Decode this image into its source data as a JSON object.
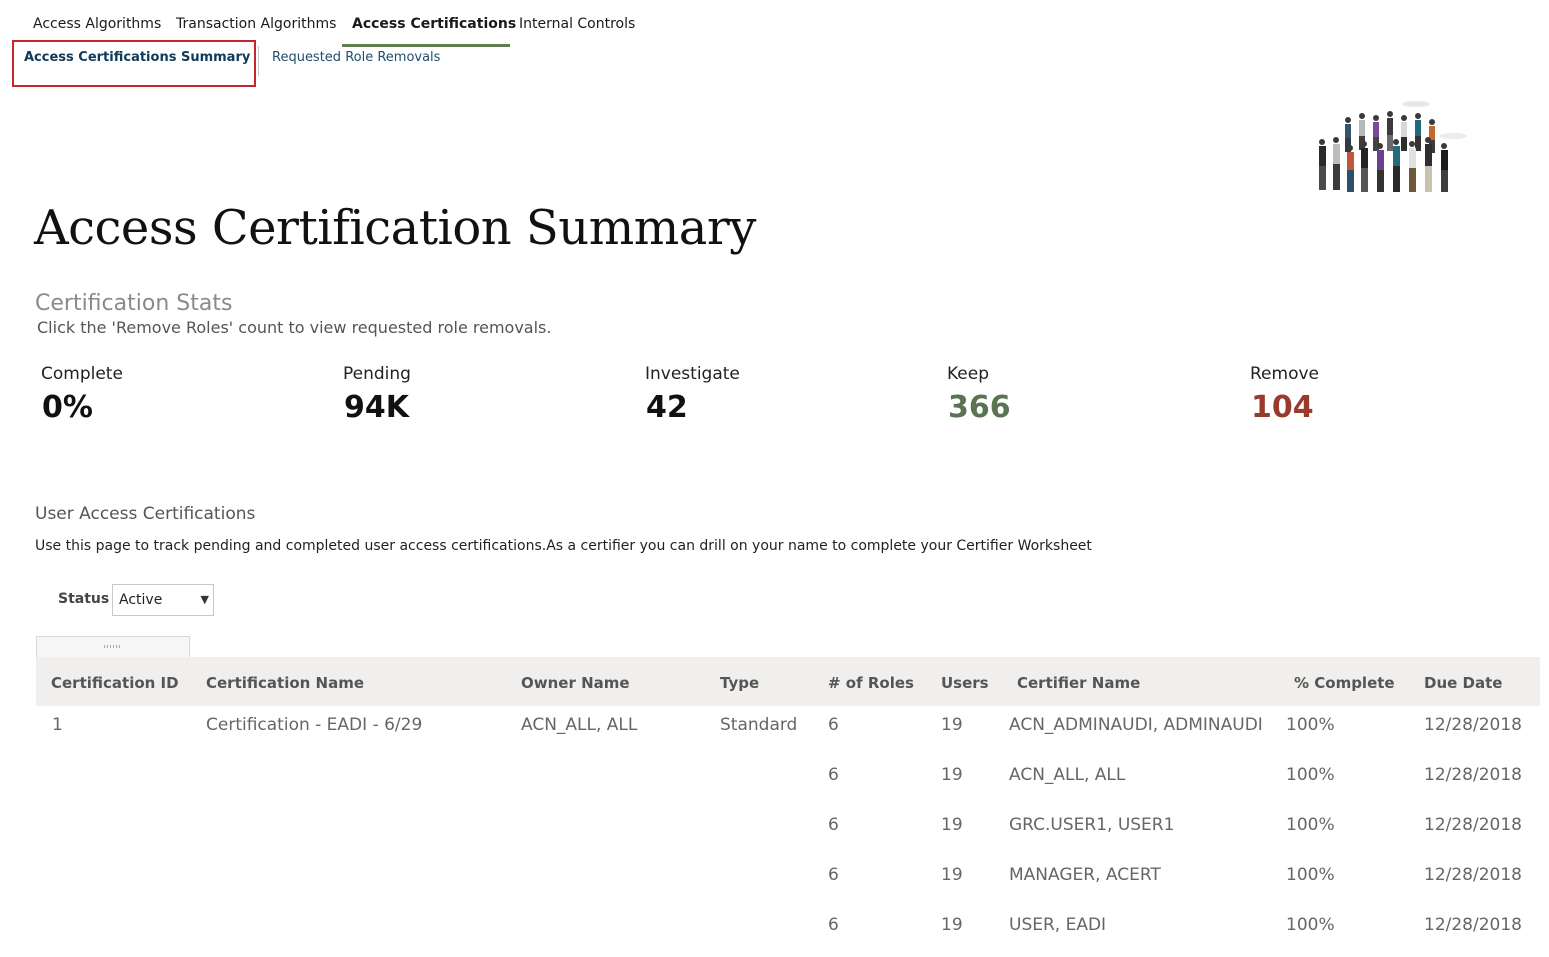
{
  "nav": {
    "tabs": [
      {
        "label": "Access Algorithms",
        "active": false
      },
      {
        "label": "Transaction Algorithms",
        "active": false
      },
      {
        "label": "Access Certifications",
        "active": true
      },
      {
        "label": "Internal Controls",
        "active": false
      }
    ],
    "subtabs": [
      {
        "label": "Access Certifications Summary",
        "active": true
      },
      {
        "label": "Requested Role Removals",
        "active": false
      }
    ]
  },
  "page": {
    "title": "Access Certification Summary"
  },
  "stats": {
    "heading": "Certification Stats",
    "help": "Click the 'Remove Roles' count to view requested role removals.",
    "items": [
      {
        "label": "Complete",
        "value": "0%"
      },
      {
        "label": "Pending",
        "value": "94K"
      },
      {
        "label": "Investigate",
        "value": "42"
      },
      {
        "label": "Keep",
        "value": "366"
      },
      {
        "label": "Remove",
        "value": "104"
      }
    ]
  },
  "colors": {
    "keep": "#5a7352",
    "remove": "#993a2e",
    "active_tab_underline": "#5f7d4f",
    "highlight_box": "#c4262e"
  },
  "certifications": {
    "heading": "User Access Certifications",
    "description": "Use this page to track pending and completed user access certifications.As a certifier you can drill on your name to complete your Certifier Worksheet",
    "filter": {
      "label": "Status",
      "value": "Active"
    },
    "columns": [
      "Certification ID",
      "Certification Name",
      "Owner Name",
      "Type",
      "# of Roles",
      "Users",
      "Certifier Name",
      "% Complete",
      "Due Date"
    ],
    "rows": [
      {
        "id": "1",
        "name": "Certification - EADI - 6/29",
        "owner": "ACN_ALL, ALL",
        "type": "Standard",
        "roles": "6",
        "users": "19",
        "certifier": "ACN_ADMINAUDI, ADMINAUDI",
        "complete": "100%",
        "due": "12/28/2018"
      },
      {
        "id": "",
        "name": "",
        "owner": "",
        "type": "",
        "roles": "6",
        "users": "19",
        "certifier": "ACN_ALL, ALL",
        "complete": "100%",
        "due": "12/28/2018"
      },
      {
        "id": "",
        "name": "",
        "owner": "",
        "type": "",
        "roles": "6",
        "users": "19",
        "certifier": "GRC.USER1, USER1",
        "complete": "100%",
        "due": "12/28/2018"
      },
      {
        "id": "",
        "name": "",
        "owner": "",
        "type": "",
        "roles": "6",
        "users": "19",
        "certifier": "MANAGER, ACERT",
        "complete": "100%",
        "due": "12/28/2018"
      },
      {
        "id": "",
        "name": "",
        "owner": "",
        "type": "",
        "roles": "6",
        "users": "19",
        "certifier": "USER, EADI",
        "complete": "100%",
        "due": "12/28/2018"
      }
    ]
  }
}
